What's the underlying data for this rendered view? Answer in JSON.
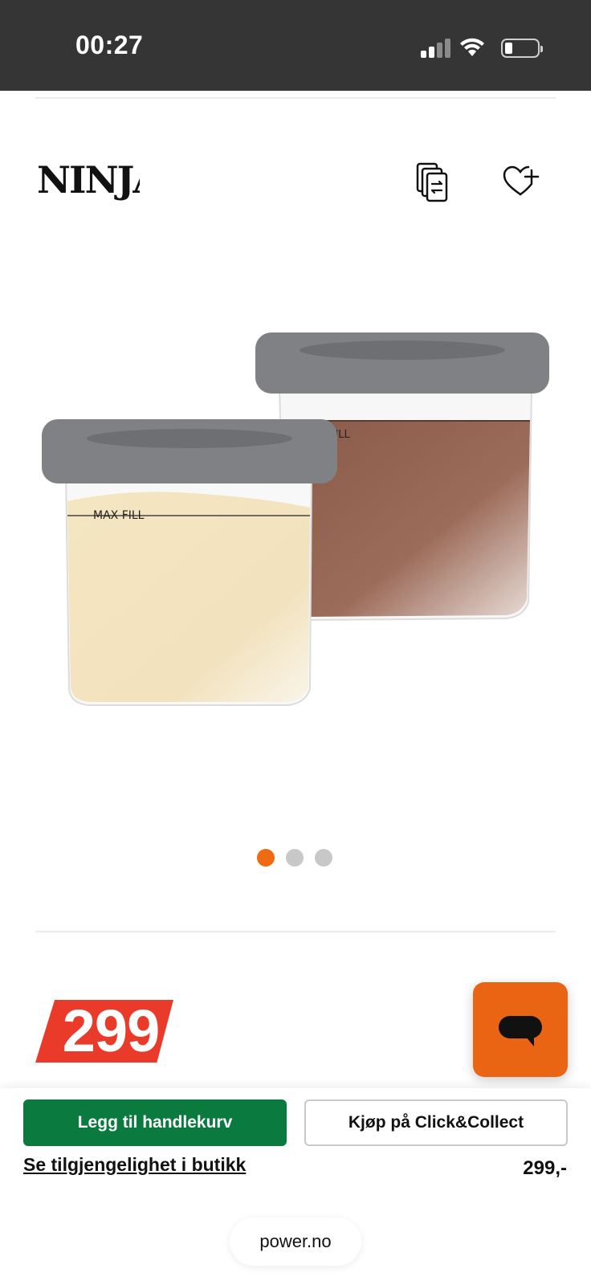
{
  "status_bar": {
    "time": "00:27"
  },
  "header": {
    "brand_logo_text": "NINJA",
    "compare_icon": "compare-icon",
    "wishlist_icon": "heart-plus-icon"
  },
  "gallery": {
    "image_labels": [
      "MAX FILL",
      "FILL"
    ],
    "total_images": 3,
    "active_index": 0
  },
  "price": {
    "badge": "299",
    "summary": "299,-"
  },
  "actions": {
    "add_to_cart": "Legg til handlekurv",
    "click_collect": "Kjøp på Click&Collect",
    "availability": "Se tilgjengelighet i butikk"
  },
  "browser": {
    "domain": "power.no"
  },
  "colors": {
    "status_bar": "#353535",
    "accent_orange": "#ef6a12",
    "price_red": "#ea3b2a",
    "cart_green": "#0a7a3f"
  }
}
